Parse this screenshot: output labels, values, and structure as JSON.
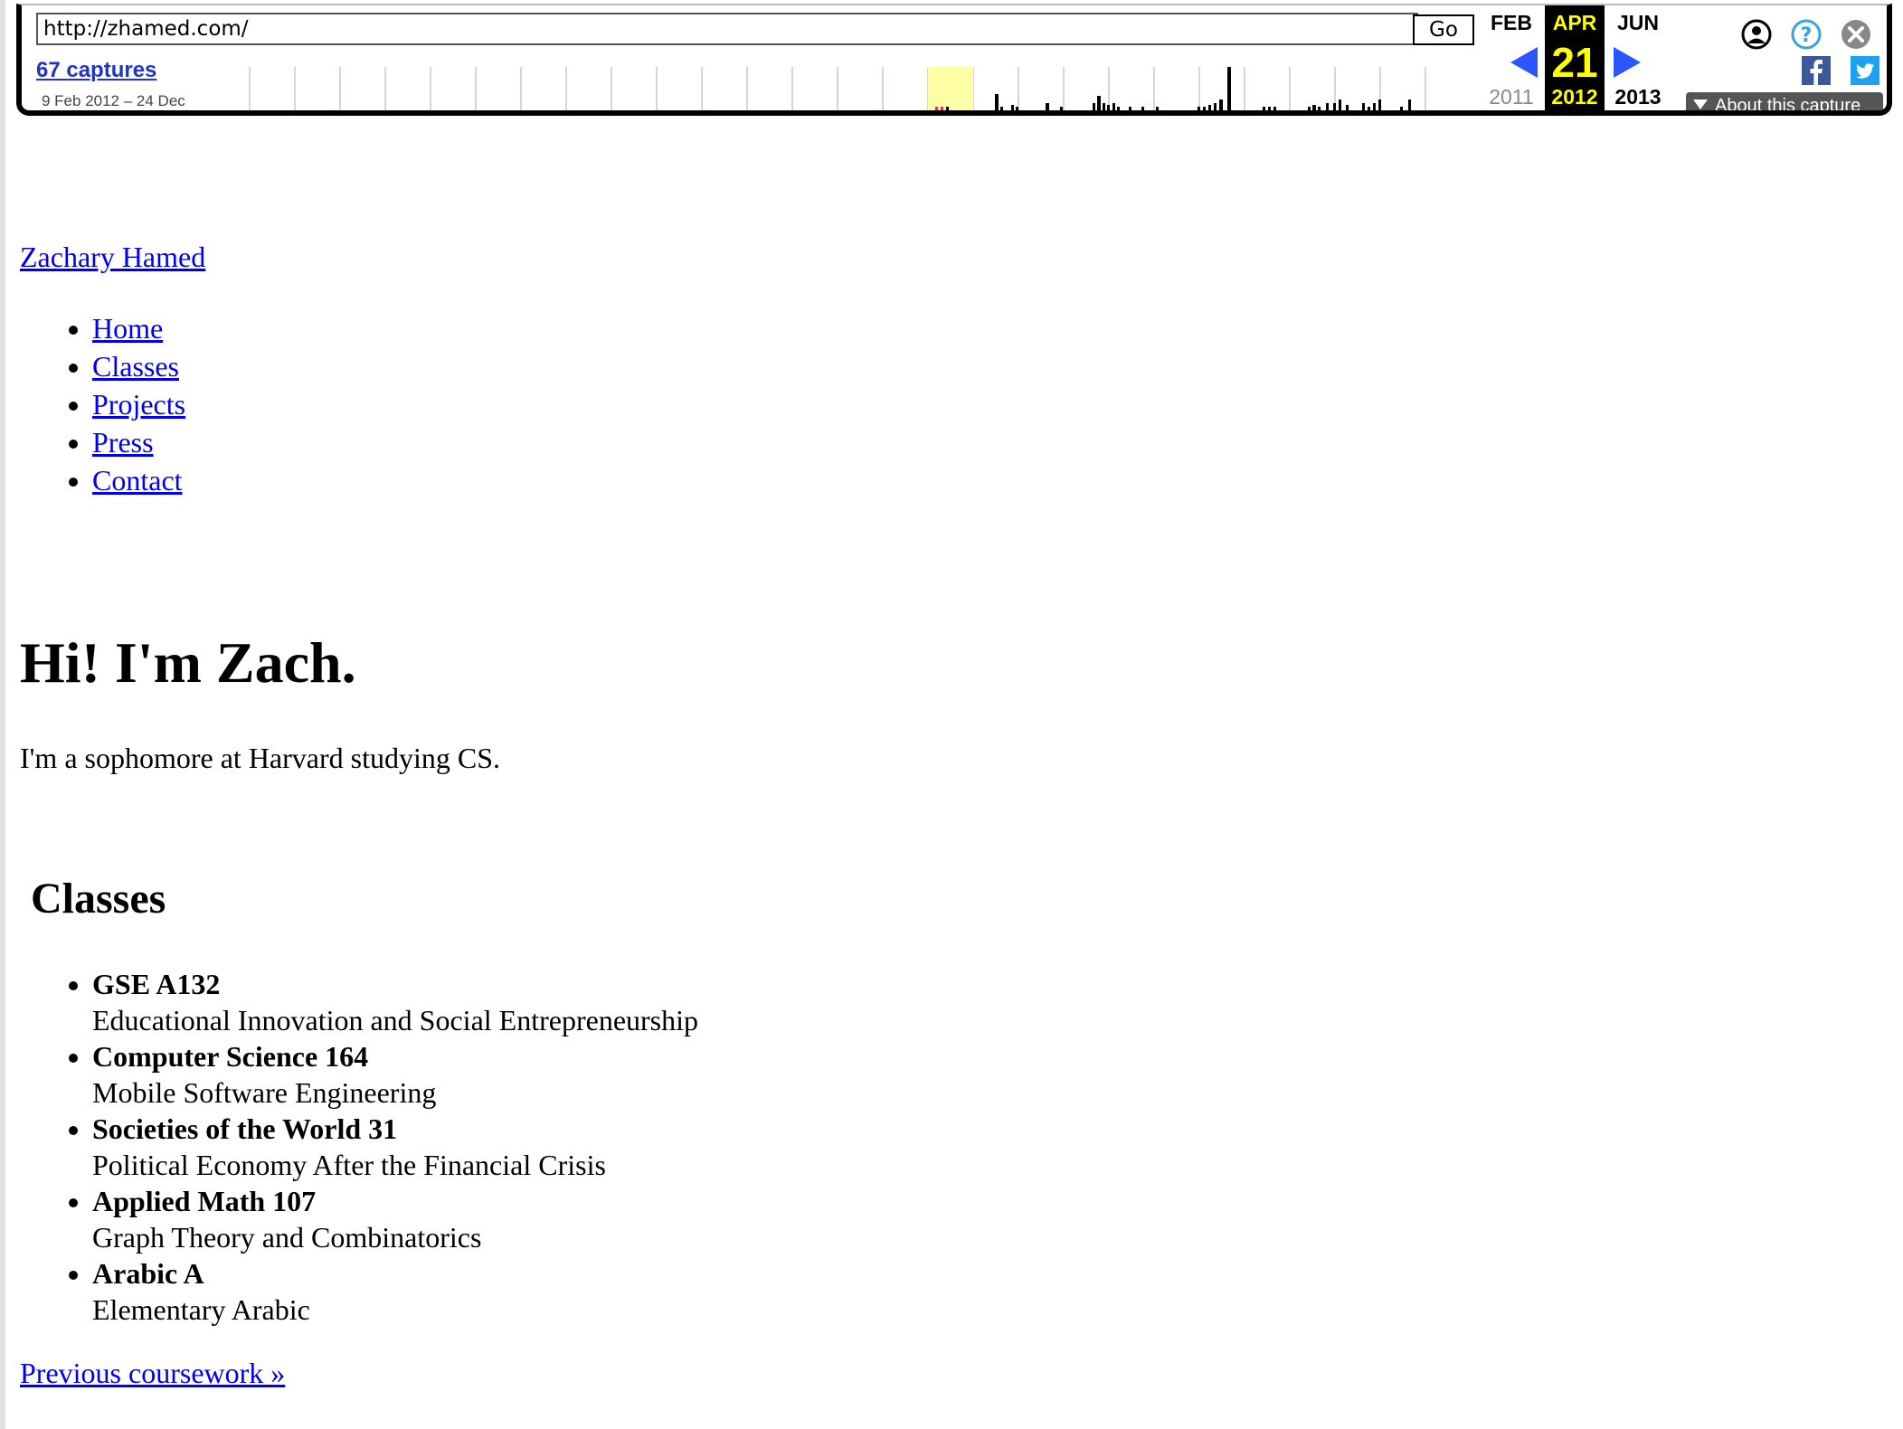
{
  "wayback": {
    "url": "http://zhamed.com/",
    "go_label": "Go",
    "captures_label": "67 captures",
    "date_range": "9 Feb 2012 – 24 Dec",
    "months": {
      "prev": "FEB",
      "current": "APR",
      "next": "JUN"
    },
    "day": "21",
    "years": {
      "prev": "2011",
      "current": "2012",
      "next": "2013"
    },
    "about_label": "About this capture",
    "colors": {
      "highlight": "#ffff00",
      "link": "#2233cc",
      "arrow": "#2a55ff"
    },
    "icons": [
      "user-icon",
      "help-icon",
      "close-icon",
      "facebook-icon",
      "twitter-icon",
      "prev-arrow-icon",
      "next-arrow-icon"
    ]
  },
  "site": {
    "title": "Zachary Hamed",
    "nav": [
      "Home",
      "Classes",
      "Projects",
      "Press",
      "Contact"
    ]
  },
  "hero": {
    "title": "Hi! I'm Zach.",
    "text": "I'm a sophomore at Harvard studying CS."
  },
  "classes": {
    "heading": "Classes",
    "items": [
      {
        "code": "GSE A132",
        "name": "Educational Innovation and Social Entrepreneurship"
      },
      {
        "code": "Computer Science 164",
        "name": "Mobile Software Engineering"
      },
      {
        "code": "Societies of the World 31",
        "name": "Political Economy After the Financial Crisis"
      },
      {
        "code": "Applied Math 107",
        "name": "Graph Theory and Combinatorics"
      },
      {
        "code": "Arabic A",
        "name": "Elementary Arabic"
      }
    ],
    "prev_link": "Previous coursework »"
  }
}
